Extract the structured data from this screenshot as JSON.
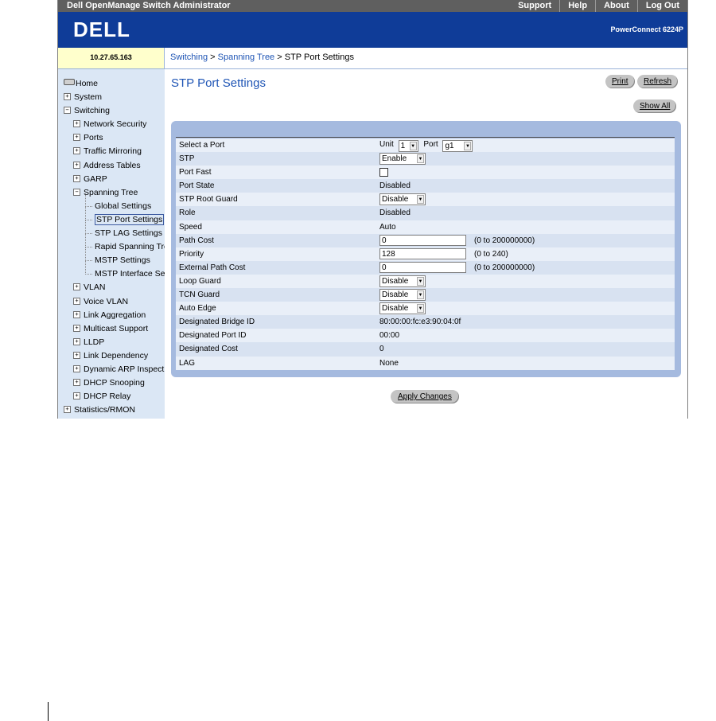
{
  "header": {
    "app_title": "Dell OpenManage Switch Administrator",
    "links": [
      "Support",
      "Help",
      "About",
      "Log Out"
    ],
    "logo_text": "DELL",
    "product": "PowerConnect 6224P"
  },
  "ip_address": "10.27.65.163",
  "breadcrumb": {
    "part1": "Switching",
    "sep1": " > ",
    "part2": "Spanning Tree",
    "sep2": " > ",
    "current": "STP Port Settings"
  },
  "nav": {
    "home": "Home",
    "system": "System",
    "switching": "Switching",
    "network_security": "Network Security",
    "ports": "Ports",
    "traffic_mirroring": "Traffic Mirroring",
    "address_tables": "Address Tables",
    "garp": "GARP",
    "spanning_tree": "Spanning Tree",
    "global_settings": "Global Settings",
    "stp_port_settings": "STP Port Settings",
    "stp_lag_settings": "STP LAG Settings",
    "rapid_spanning_tree": "Rapid Spanning Tree",
    "mstp_settings": "MSTP Settings",
    "mstp_interface_settings": "MSTP Interface Settings",
    "vlan": "VLAN",
    "voice_vlan": "Voice VLAN",
    "link_aggregation": "Link Aggregation",
    "multicast_support": "Multicast Support",
    "lldp": "LLDP",
    "link_dependency": "Link Dependency",
    "dynamic_arp": "Dynamic ARP Inspection",
    "dhcp_snooping": "DHCP Snooping",
    "dhcp_relay": "DHCP Relay",
    "statistics": "Statistics/RMON",
    "expand_glyph": "+",
    "collapse_glyph": "−"
  },
  "page": {
    "title": "STP Port Settings",
    "print": "Print",
    "refresh": "Refresh",
    "show_all": "Show All",
    "apply": "Apply Changes"
  },
  "form": {
    "select_port_label": "Select a Port",
    "unit_label": "Unit",
    "unit_value": "1",
    "port_label": "Port",
    "port_value": "g1",
    "stp_label": "STP",
    "stp_value": "Enable",
    "port_fast_label": "Port Fast",
    "port_state_label": "Port State",
    "port_state_value": "Disabled",
    "root_guard_label": "STP Root Guard",
    "root_guard_value": "Disable",
    "role_label": "Role",
    "role_value": "Disabled",
    "speed_label": "Speed",
    "speed_value": "Auto",
    "path_cost_label": "Path Cost",
    "path_cost_value": "0",
    "path_cost_hint": "(0 to 200000000)",
    "priority_label": "Priority",
    "priority_value": "128",
    "priority_hint": "(0 to 240)",
    "ext_path_cost_label": "External Path Cost",
    "ext_path_cost_value": "0",
    "ext_path_cost_hint": "(0 to 200000000)",
    "loop_guard_label": "Loop Guard",
    "loop_guard_value": "Disable",
    "tcn_guard_label": "TCN Guard",
    "tcn_guard_value": "Disable",
    "auto_edge_label": "Auto Edge",
    "auto_edge_value": "Disable",
    "bridge_id_label": "Designated Bridge ID",
    "bridge_id_value": "80:00:00:fc:e3:90:04:0f",
    "port_id_label": "Designated Port ID",
    "port_id_value": "00:00",
    "cost_label": "Designated Cost",
    "cost_value": "0",
    "lag_label": "LAG",
    "lag_value": "None",
    "dropdown_arrow": "▼"
  }
}
